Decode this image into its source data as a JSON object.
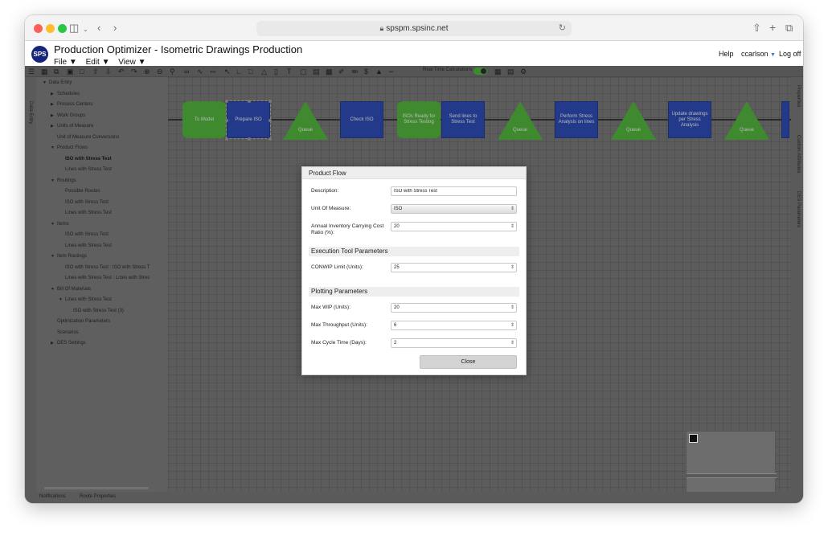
{
  "browser": {
    "url": "spspm.spsinc.net"
  },
  "app": {
    "logo_text": "SPS",
    "title": "Production Optimizer - Isometric Drawings Production",
    "menus": [
      "File",
      "Edit",
      "View"
    ],
    "help_label": "Help",
    "user_label": "ccarlson",
    "logout_label": "Log off"
  },
  "toolbar": {
    "realtime_label": "Real Time Calculations"
  },
  "side_tabs": {
    "left": "Data Entry",
    "right": [
      "Properties",
      "Custom Attributes",
      "DES Parameters"
    ]
  },
  "tree": {
    "items": [
      {
        "label": "Data Entry",
        "level": 0,
        "expand": "open"
      },
      {
        "label": "Schedules",
        "level": 1,
        "expand": "closed"
      },
      {
        "label": "Process Centers",
        "level": 1,
        "expand": "closed"
      },
      {
        "label": "Work Groups",
        "level": 1,
        "expand": "closed"
      },
      {
        "label": "Units of Measure",
        "level": 1,
        "expand": "closed"
      },
      {
        "label": "Unit of Measure Conversions",
        "level": 1,
        "expand": "none"
      },
      {
        "label": "Product Flows",
        "level": 1,
        "expand": "open"
      },
      {
        "label": "ISO with Stress Test",
        "level": 2,
        "expand": "none",
        "bold": true
      },
      {
        "label": "Lines with Stress Test",
        "level": 2,
        "expand": "none"
      },
      {
        "label": "Routings",
        "level": 1,
        "expand": "open"
      },
      {
        "label": "Possible Routes",
        "level": 2,
        "expand": "none"
      },
      {
        "label": "ISO with Stress Test",
        "level": 2,
        "expand": "none"
      },
      {
        "label": "Lines with Stress Test",
        "level": 2,
        "expand": "none"
      },
      {
        "label": "Items",
        "level": 1,
        "expand": "open"
      },
      {
        "label": "ISO with Stress Test",
        "level": 2,
        "expand": "none"
      },
      {
        "label": "Lines with Stress Test",
        "level": 2,
        "expand": "none"
      },
      {
        "label": "Item Routings",
        "level": 1,
        "expand": "open"
      },
      {
        "label": "ISO with Stress Test : ISO with Stress T",
        "level": 2,
        "expand": "none"
      },
      {
        "label": "Lines with Stress Test : Lines with Stres",
        "level": 2,
        "expand": "none"
      },
      {
        "label": "Bill Of Materials",
        "level": 1,
        "expand": "open"
      },
      {
        "label": "Lines with Stress Test",
        "level": 2,
        "expand": "open"
      },
      {
        "label": "ISO with Stress Test (3)",
        "level": 3,
        "expand": "none"
      },
      {
        "label": "Optimization Parameters",
        "level": 1,
        "expand": "none"
      },
      {
        "label": "Scenarios",
        "level": 1,
        "expand": "none"
      },
      {
        "label": "DES Settings",
        "level": 1,
        "expand": "closed"
      }
    ]
  },
  "bottom_tabs": [
    "Notifications",
    "Route Properties"
  ],
  "flow_nodes": [
    {
      "kind": "cyl",
      "label": "To Model"
    },
    {
      "kind": "box",
      "label": "Prepare ISO",
      "selected": true
    },
    {
      "kind": "tri",
      "label": "Queue"
    },
    {
      "kind": "box",
      "label": "Check ISO"
    },
    {
      "kind": "cyl",
      "label": "ISOs Ready for Stress Testing"
    },
    {
      "kind": "box",
      "label": "Send lines to Stress Test"
    },
    {
      "kind": "tri",
      "label": "Queue"
    },
    {
      "kind": "box",
      "label": "Perform Stress Analysis on lines"
    },
    {
      "kind": "tri",
      "label": "Queue"
    },
    {
      "kind": "box",
      "label": "Update drawings per Stress Analysis"
    },
    {
      "kind": "tri",
      "label": "Queue"
    },
    {
      "kind": "box",
      "label": ""
    }
  ],
  "modal": {
    "title": "Product Flow",
    "description_label": "Description:",
    "description_value": "ISO with Stress Test",
    "uom_label": "Unit Of Measure:",
    "uom_value": "ISO",
    "carrying_label": "Annual Inventory Carrying Cost Ratio (%):",
    "carrying_value": "20",
    "execution_section": "Execution Tool Parameters",
    "conwip_label": "CONWIP Limit (Units):",
    "conwip_value": "25",
    "plotting_section": "Plotting Parameters",
    "max_wip_label": "Max WIP (Units):",
    "max_wip_value": "20",
    "max_throughput_label": "Max Throughput (Units):",
    "max_throughput_value": "6",
    "max_cycle_label": "Max Cycle Time (Days):",
    "max_cycle_value": "2",
    "close_label": "Close"
  },
  "colors": {
    "box_fill": "#233a8a",
    "cylinder_fill": "#3f8a2e",
    "triangle_fill": "#3f8a2e",
    "logo_bg": "#15257a"
  }
}
